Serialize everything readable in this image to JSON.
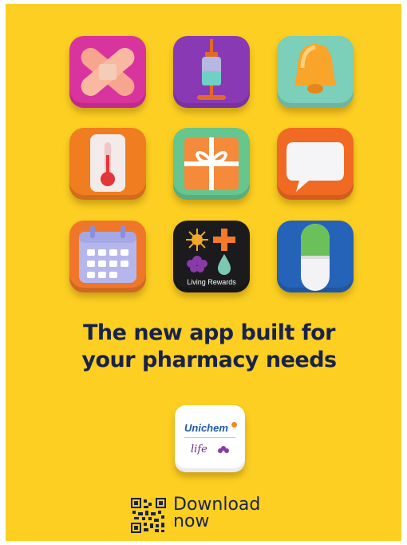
{
  "tiles": [
    {
      "name": "bandage-icon"
    },
    {
      "name": "syringe-icon"
    },
    {
      "name": "bell-icon"
    },
    {
      "name": "thermometer-icon"
    },
    {
      "name": "gift-icon"
    },
    {
      "name": "chat-bubble-icon"
    },
    {
      "name": "calendar-icon"
    },
    {
      "name": "living-rewards-icon",
      "label": "Living Rewards"
    },
    {
      "name": "capsule-icon"
    }
  ],
  "headline": {
    "line1": "The new app built for",
    "line2": "your pharmacy needs"
  },
  "app_logo": {
    "brand": "Unichem",
    "sub_brand": "life"
  },
  "download": {
    "line1": "Download",
    "line2": "now"
  },
  "colors": {
    "background": "#fccf22",
    "headline": "#19224a",
    "brand_blue": "#1f5aa8",
    "brand_purple": "#6a2a86"
  }
}
